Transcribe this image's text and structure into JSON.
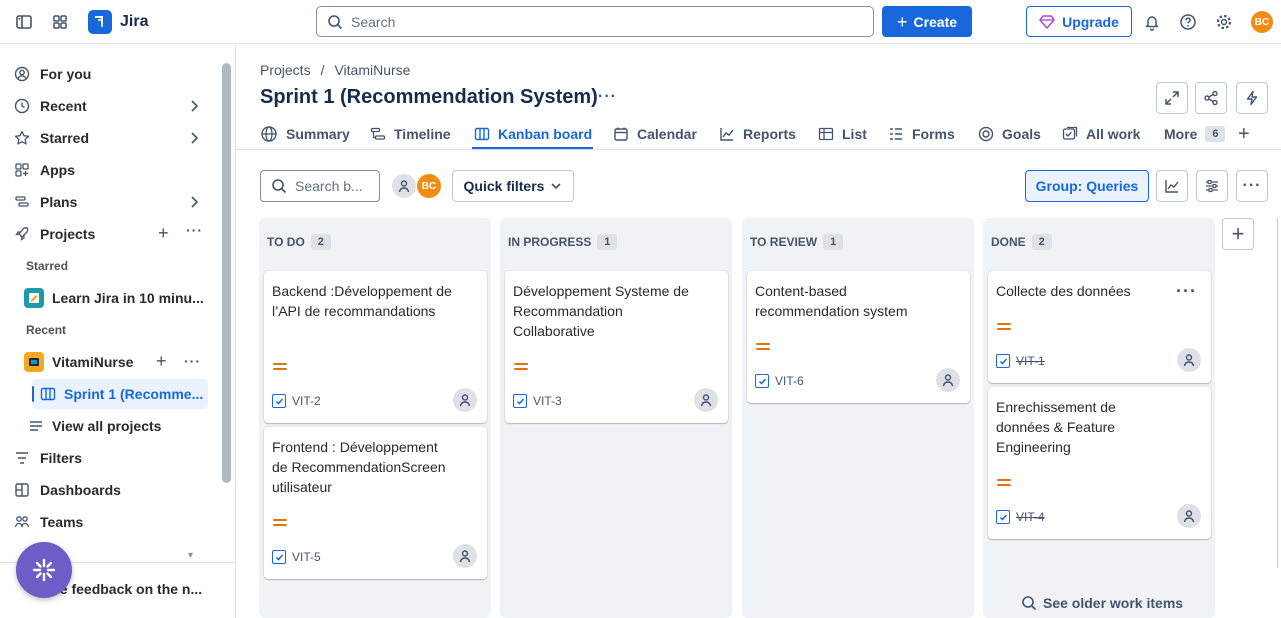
{
  "topbar": {
    "app_name": "Jira",
    "search_placeholder": "Search",
    "create_label": "Create",
    "upgrade_label": "Upgrade",
    "user_initials": "BC"
  },
  "sidebar": {
    "items": [
      {
        "label": "For you",
        "icon": "user-circle-icon"
      },
      {
        "label": "Recent",
        "icon": "clock-icon"
      },
      {
        "label": "Starred",
        "icon": "star-icon"
      },
      {
        "label": "Apps",
        "icon": "apps-icon"
      },
      {
        "label": "Plans",
        "icon": "plans-icon"
      },
      {
        "label": "Projects",
        "icon": "rocket-icon"
      }
    ],
    "starred_heading": "Starred",
    "starred_project": "Learn Jira in 10 minu...",
    "recent_heading": "Recent",
    "recent_project": "VitamiNurse",
    "selected_board": "Sprint 1 (Recomme...",
    "view_all": "View all projects",
    "bottom_items": [
      {
        "label": "Filters",
        "icon": "filter-icon"
      },
      {
        "label": "Dashboards",
        "icon": "dashboard-icon"
      },
      {
        "label": "Teams",
        "icon": "teams-icon"
      }
    ],
    "feedback_text": "ve feedback on the n..."
  },
  "breadcrumb": {
    "root": "Projects",
    "separator": "/",
    "project": "VitamiNurse"
  },
  "page_title": "Sprint 1 (Recommendation System)",
  "tabs": [
    {
      "label": "Summary",
      "icon": "globe-icon"
    },
    {
      "label": "Timeline",
      "icon": "timeline-icon"
    },
    {
      "label": "Kanban board",
      "icon": "board-icon",
      "active": true
    },
    {
      "label": "Calendar",
      "icon": "calendar-icon"
    },
    {
      "label": "Reports",
      "icon": "chart-icon"
    },
    {
      "label": "List",
      "icon": "list-icon"
    },
    {
      "label": "Forms",
      "icon": "forms-icon"
    },
    {
      "label": "Goals",
      "icon": "target-icon"
    },
    {
      "label": "All work",
      "icon": "all-work-icon"
    }
  ],
  "more_tab": {
    "label": "More",
    "count": "6"
  },
  "toolbar": {
    "search_placeholder": "Search b...",
    "quick_filters": "Quick filters",
    "group_label": "Group: Queries"
  },
  "columns": [
    {
      "name": "TO DO",
      "count": "2",
      "cards": [
        {
          "title": "Backend :Développement de l’API de recommandations",
          "key": "VIT-2",
          "done": false
        },
        {
          "title": "Frontend : Développement de RecommendationScreen utilisateur",
          "key": "VIT-5",
          "done": false
        }
      ]
    },
    {
      "name": "IN PROGRESS",
      "count": "1",
      "cards": [
        {
          "title": "Développement Systeme de Recommandation Collaborative",
          "key": "VIT-3",
          "done": false
        }
      ]
    },
    {
      "name": "TO REVIEW",
      "count": "1",
      "cards": [
        {
          "title": "Content-based recommendation system",
          "key": "VIT-6",
          "done": false
        }
      ]
    },
    {
      "name": "DONE",
      "count": "2",
      "cards": [
        {
          "title": "Collecte des données",
          "key": "VIT-1",
          "done": true
        },
        {
          "title": "Enrechissement de données & Feature Engineering",
          "key": "VIT-4",
          "done": true
        }
      ],
      "footer": "See older work items"
    }
  ],
  "colors": {
    "accent": "#1868db",
    "priority_medium": "#e2740b",
    "avatar": "#f18d13",
    "feedback": "#6e5dc6"
  }
}
